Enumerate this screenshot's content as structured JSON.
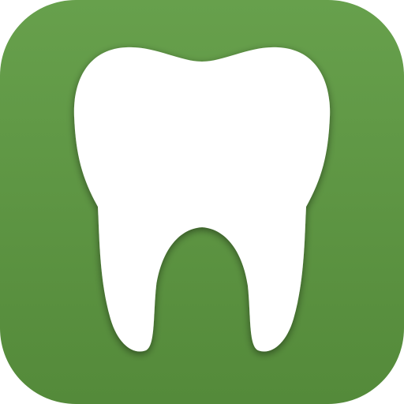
{
  "icon": "tooth-icon",
  "colors": {
    "background_top": "#67a04c",
    "background_bottom": "#548a3a",
    "tooth": "#ffffff",
    "tooth_shadow": "#1f3a13"
  }
}
